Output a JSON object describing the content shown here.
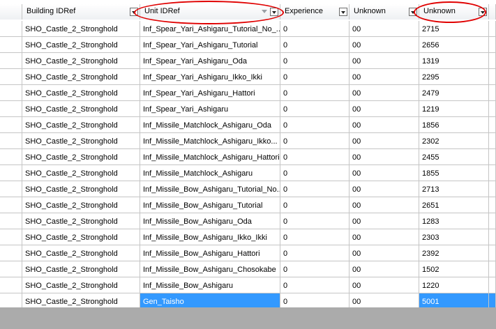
{
  "columns": [
    "Building IDRef",
    "Unit IDRef",
    "Experience",
    "Unknown",
    "Unknown"
  ],
  "rows": [
    [
      "SHO_Castle_2_Stronghold",
      "Inf_Spear_Yari_Ashigaru_Tutorial_No_...",
      "0",
      "00",
      "2715"
    ],
    [
      "SHO_Castle_2_Stronghold",
      "Inf_Spear_Yari_Ashigaru_Tutorial",
      "0",
      "00",
      "2656"
    ],
    [
      "SHO_Castle_2_Stronghold",
      "Inf_Spear_Yari_Ashigaru_Oda",
      "0",
      "00",
      "1319"
    ],
    [
      "SHO_Castle_2_Stronghold",
      "Inf_Spear_Yari_Ashigaru_Ikko_Ikki",
      "0",
      "00",
      "2295"
    ],
    [
      "SHO_Castle_2_Stronghold",
      "Inf_Spear_Yari_Ashigaru_Hattori",
      "0",
      "00",
      "2479"
    ],
    [
      "SHO_Castle_2_Stronghold",
      "Inf_Spear_Yari_Ashigaru",
      "0",
      "00",
      "1219"
    ],
    [
      "SHO_Castle_2_Stronghold",
      "Inf_Missile_Matchlock_Ashigaru_Oda",
      "0",
      "00",
      "1856"
    ],
    [
      "SHO_Castle_2_Stronghold",
      "Inf_Missile_Matchlock_Ashigaru_Ikko...",
      "0",
      "00",
      "2302"
    ],
    [
      "SHO_Castle_2_Stronghold",
      "Inf_Missile_Matchlock_Ashigaru_Hattori",
      "0",
      "00",
      "2455"
    ],
    [
      "SHO_Castle_2_Stronghold",
      "Inf_Missile_Matchlock_Ashigaru",
      "0",
      "00",
      "1855"
    ],
    [
      "SHO_Castle_2_Stronghold",
      "Inf_Missile_Bow_Ashigaru_Tutorial_No...",
      "0",
      "00",
      "2713"
    ],
    [
      "SHO_Castle_2_Stronghold",
      "Inf_Missile_Bow_Ashigaru_Tutorial",
      "0",
      "00",
      "2651"
    ],
    [
      "SHO_Castle_2_Stronghold",
      "Inf_Missile_Bow_Ashigaru_Oda",
      "0",
      "00",
      "1283"
    ],
    [
      "SHO_Castle_2_Stronghold",
      "Inf_Missile_Bow_Ashigaru_Ikko_Ikki",
      "0",
      "00",
      "2303"
    ],
    [
      "SHO_Castle_2_Stronghold",
      "Inf_Missile_Bow_Ashigaru_Hattori",
      "0",
      "00",
      "2392"
    ],
    [
      "SHO_Castle_2_Stronghold",
      "Inf_Missile_Bow_Ashigaru_Chosokabe",
      "0",
      "00",
      "1502"
    ],
    [
      "SHO_Castle_2_Stronghold",
      "Inf_Missile_Bow_Ashigaru",
      "0",
      "00",
      "1220"
    ],
    [
      "SHO_Castle_2_Stronghold",
      "Gen_Taisho",
      "0",
      "00",
      "5001"
    ]
  ],
  "selected_cells": [
    [
      17,
      1
    ],
    [
      17,
      4
    ]
  ],
  "annotation_color": "#e00000",
  "selection_color": "#3399ff",
  "icons": {
    "header_dropdown": "chevron-down-icon",
    "sort_indicator": "sort-arrow-icon"
  }
}
